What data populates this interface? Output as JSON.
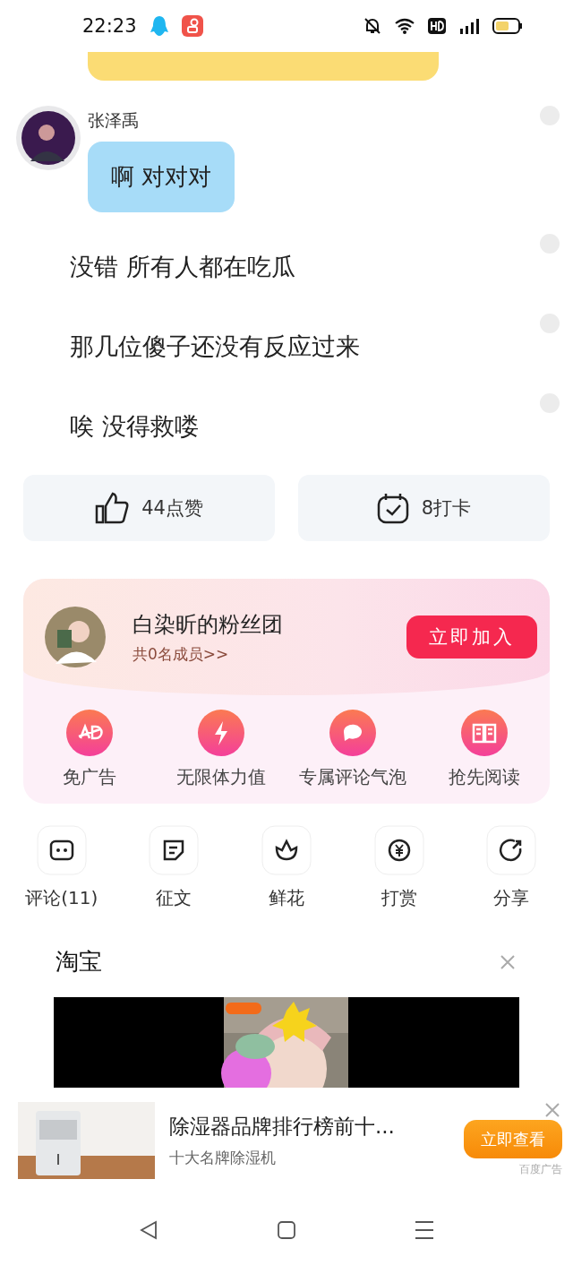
{
  "status_bar": {
    "time": "22:23"
  },
  "chat": {
    "sender": "张泽禹",
    "bubble": "啊 对对对",
    "lines": [
      "没错 所有人都在吃瓜",
      "那几位傻子还没有反应过来",
      "唉 没得救喽"
    ]
  },
  "reactions": [
    {
      "kind": "like",
      "label": "44点赞"
    },
    {
      "kind": "checkin",
      "label": "8打卡"
    }
  ],
  "fan_club": {
    "title": "白染昕的粉丝团",
    "members": "共0名成员>>",
    "join": "立即加入",
    "perks": [
      {
        "kind": "ad",
        "label": "免广告"
      },
      {
        "kind": "bolt",
        "label": "无限体力值"
      },
      {
        "kind": "bubble",
        "label": "专属评论气泡"
      },
      {
        "kind": "book",
        "label": "抢先阅读"
      }
    ]
  },
  "actions": [
    {
      "kind": "comment",
      "label": "评论(11)"
    },
    {
      "kind": "essay",
      "label": "征文"
    },
    {
      "kind": "flower",
      "label": "鲜花"
    },
    {
      "kind": "tip",
      "label": "打赏"
    },
    {
      "kind": "share",
      "label": "分享"
    }
  ],
  "ad_video": {
    "title": "淘宝"
  },
  "ad_banner": {
    "title": "除湿器品牌排行榜前十...",
    "subtitle": "十大名牌除湿机",
    "button": "立即查看",
    "source": "百度广告"
  }
}
